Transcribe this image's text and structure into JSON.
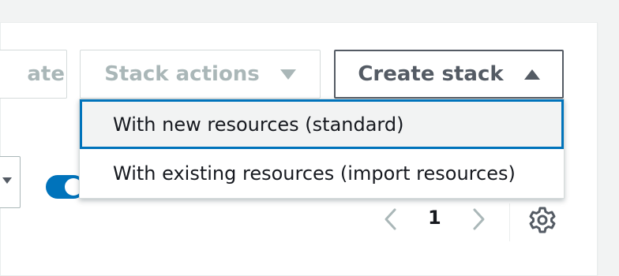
{
  "toolbar": {
    "update_label": "ate",
    "stack_actions_label": "Stack actions",
    "create_stack_label": "Create stack"
  },
  "create_stack_menu": {
    "items": [
      {
        "label": "With new resources (standard)"
      },
      {
        "label": "With existing resources (import resources)"
      }
    ]
  },
  "pagination": {
    "current_page": "1"
  },
  "icons": {
    "stack_actions_caret": "caret-down-icon",
    "create_stack_caret": "caret-up-icon",
    "prev": "chevron-left-icon",
    "next": "chevron-right-icon",
    "settings": "gear-icon",
    "select": "chevron-down-icon"
  },
  "colors": {
    "accent": "#0073bb",
    "disabled_text": "#aab7b8",
    "button_text": "#545b64",
    "text": "#16191f"
  }
}
